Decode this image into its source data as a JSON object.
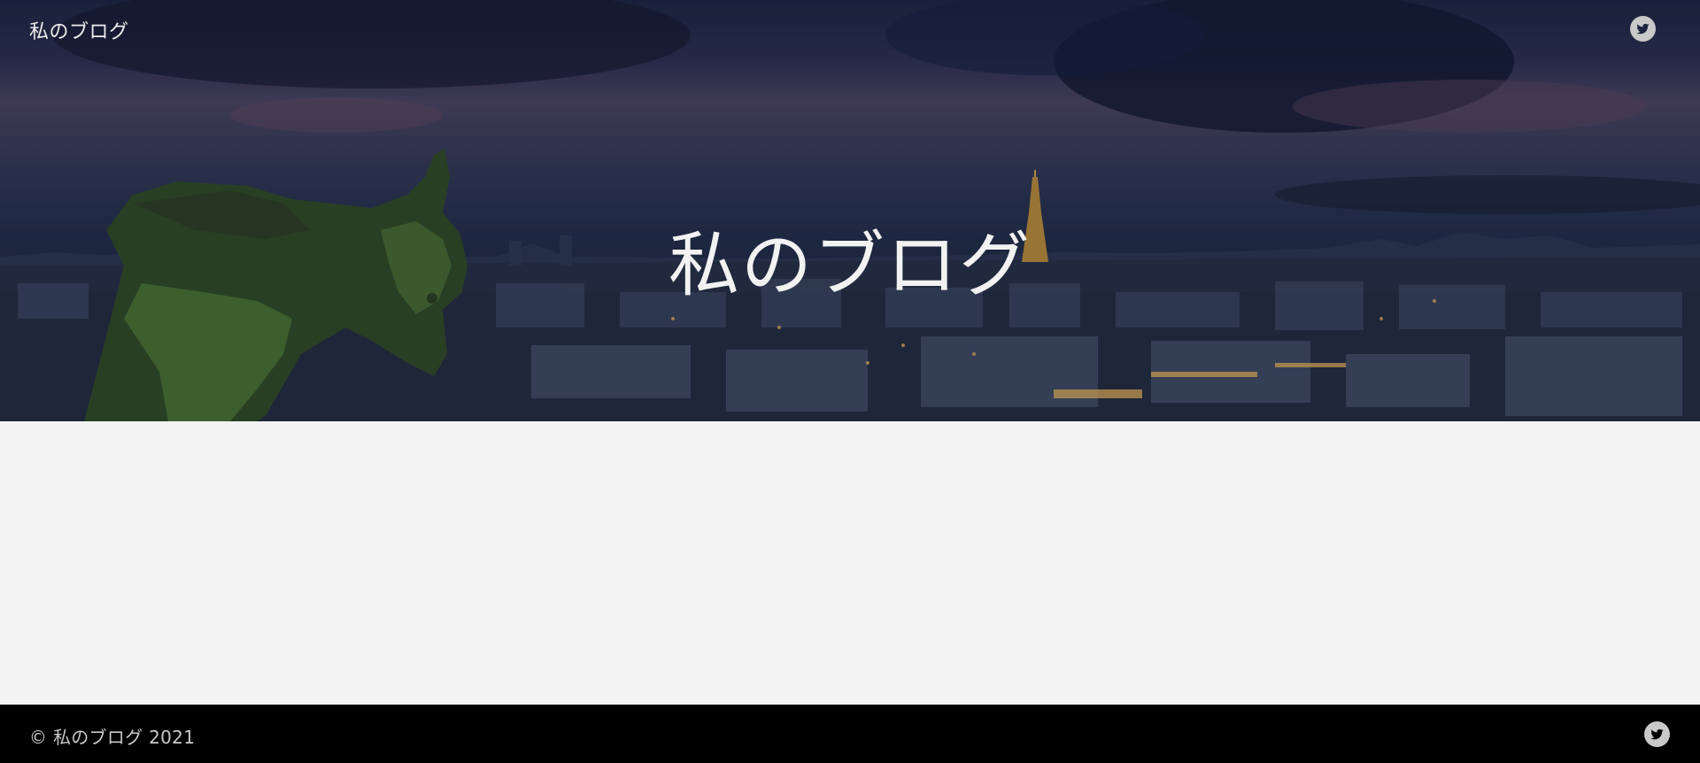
{
  "header": {
    "site_name": "私のブログ",
    "twitter_icon": "twitter-icon"
  },
  "hero": {
    "title": "私のブログ"
  },
  "footer": {
    "copyright": "© 私のブログ 2021",
    "twitter_icon": "twitter-icon"
  },
  "colors": {
    "hero_overlay": "#1d2440",
    "page_background": "#f3f3f3",
    "footer_background": "#000000",
    "icon_background": "#c9c9c9"
  }
}
